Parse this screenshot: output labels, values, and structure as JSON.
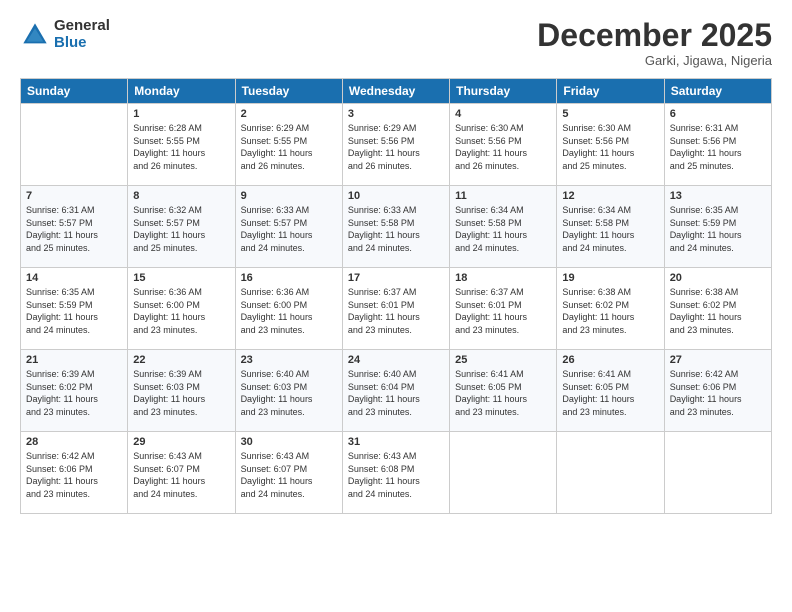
{
  "header": {
    "logo_general": "General",
    "logo_blue": "Blue",
    "month_title": "December 2025",
    "subtitle": "Garki, Jigawa, Nigeria"
  },
  "weekdays": [
    "Sunday",
    "Monday",
    "Tuesday",
    "Wednesday",
    "Thursday",
    "Friday",
    "Saturday"
  ],
  "weeks": [
    [
      {
        "day": "",
        "info": ""
      },
      {
        "day": "1",
        "info": "Sunrise: 6:28 AM\nSunset: 5:55 PM\nDaylight: 11 hours\nand 26 minutes."
      },
      {
        "day": "2",
        "info": "Sunrise: 6:29 AM\nSunset: 5:55 PM\nDaylight: 11 hours\nand 26 minutes."
      },
      {
        "day": "3",
        "info": "Sunrise: 6:29 AM\nSunset: 5:56 PM\nDaylight: 11 hours\nand 26 minutes."
      },
      {
        "day": "4",
        "info": "Sunrise: 6:30 AM\nSunset: 5:56 PM\nDaylight: 11 hours\nand 26 minutes."
      },
      {
        "day": "5",
        "info": "Sunrise: 6:30 AM\nSunset: 5:56 PM\nDaylight: 11 hours\nand 25 minutes."
      },
      {
        "day": "6",
        "info": "Sunrise: 6:31 AM\nSunset: 5:56 PM\nDaylight: 11 hours\nand 25 minutes."
      }
    ],
    [
      {
        "day": "7",
        "info": "Sunrise: 6:31 AM\nSunset: 5:57 PM\nDaylight: 11 hours\nand 25 minutes."
      },
      {
        "day": "8",
        "info": "Sunrise: 6:32 AM\nSunset: 5:57 PM\nDaylight: 11 hours\nand 25 minutes."
      },
      {
        "day": "9",
        "info": "Sunrise: 6:33 AM\nSunset: 5:57 PM\nDaylight: 11 hours\nand 24 minutes."
      },
      {
        "day": "10",
        "info": "Sunrise: 6:33 AM\nSunset: 5:58 PM\nDaylight: 11 hours\nand 24 minutes."
      },
      {
        "day": "11",
        "info": "Sunrise: 6:34 AM\nSunset: 5:58 PM\nDaylight: 11 hours\nand 24 minutes."
      },
      {
        "day": "12",
        "info": "Sunrise: 6:34 AM\nSunset: 5:58 PM\nDaylight: 11 hours\nand 24 minutes."
      },
      {
        "day": "13",
        "info": "Sunrise: 6:35 AM\nSunset: 5:59 PM\nDaylight: 11 hours\nand 24 minutes."
      }
    ],
    [
      {
        "day": "14",
        "info": "Sunrise: 6:35 AM\nSunset: 5:59 PM\nDaylight: 11 hours\nand 24 minutes."
      },
      {
        "day": "15",
        "info": "Sunrise: 6:36 AM\nSunset: 6:00 PM\nDaylight: 11 hours\nand 23 minutes."
      },
      {
        "day": "16",
        "info": "Sunrise: 6:36 AM\nSunset: 6:00 PM\nDaylight: 11 hours\nand 23 minutes."
      },
      {
        "day": "17",
        "info": "Sunrise: 6:37 AM\nSunset: 6:01 PM\nDaylight: 11 hours\nand 23 minutes."
      },
      {
        "day": "18",
        "info": "Sunrise: 6:37 AM\nSunset: 6:01 PM\nDaylight: 11 hours\nand 23 minutes."
      },
      {
        "day": "19",
        "info": "Sunrise: 6:38 AM\nSunset: 6:02 PM\nDaylight: 11 hours\nand 23 minutes."
      },
      {
        "day": "20",
        "info": "Sunrise: 6:38 AM\nSunset: 6:02 PM\nDaylight: 11 hours\nand 23 minutes."
      }
    ],
    [
      {
        "day": "21",
        "info": "Sunrise: 6:39 AM\nSunset: 6:02 PM\nDaylight: 11 hours\nand 23 minutes."
      },
      {
        "day": "22",
        "info": "Sunrise: 6:39 AM\nSunset: 6:03 PM\nDaylight: 11 hours\nand 23 minutes."
      },
      {
        "day": "23",
        "info": "Sunrise: 6:40 AM\nSunset: 6:03 PM\nDaylight: 11 hours\nand 23 minutes."
      },
      {
        "day": "24",
        "info": "Sunrise: 6:40 AM\nSunset: 6:04 PM\nDaylight: 11 hours\nand 23 minutes."
      },
      {
        "day": "25",
        "info": "Sunrise: 6:41 AM\nSunset: 6:05 PM\nDaylight: 11 hours\nand 23 minutes."
      },
      {
        "day": "26",
        "info": "Sunrise: 6:41 AM\nSunset: 6:05 PM\nDaylight: 11 hours\nand 23 minutes."
      },
      {
        "day": "27",
        "info": "Sunrise: 6:42 AM\nSunset: 6:06 PM\nDaylight: 11 hours\nand 23 minutes."
      }
    ],
    [
      {
        "day": "28",
        "info": "Sunrise: 6:42 AM\nSunset: 6:06 PM\nDaylight: 11 hours\nand 23 minutes."
      },
      {
        "day": "29",
        "info": "Sunrise: 6:43 AM\nSunset: 6:07 PM\nDaylight: 11 hours\nand 24 minutes."
      },
      {
        "day": "30",
        "info": "Sunrise: 6:43 AM\nSunset: 6:07 PM\nDaylight: 11 hours\nand 24 minutes."
      },
      {
        "day": "31",
        "info": "Sunrise: 6:43 AM\nSunset: 6:08 PM\nDaylight: 11 hours\nand 24 minutes."
      },
      {
        "day": "",
        "info": ""
      },
      {
        "day": "",
        "info": ""
      },
      {
        "day": "",
        "info": ""
      }
    ]
  ]
}
